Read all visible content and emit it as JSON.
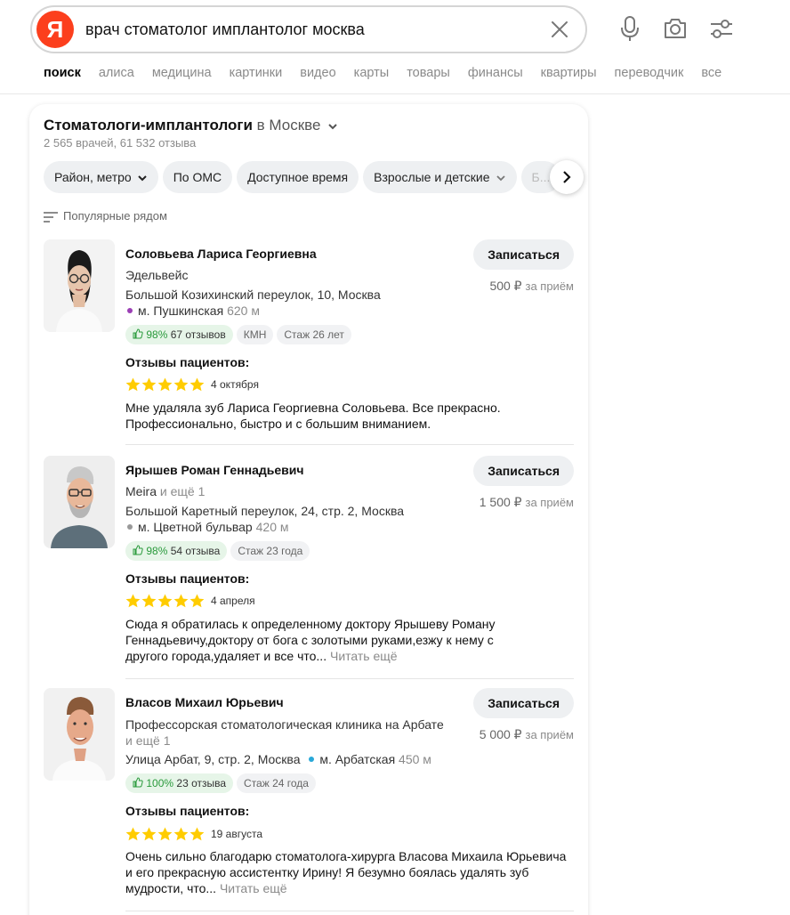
{
  "search": {
    "logo": "Я",
    "query": "врач стоматолог имплантолог москва"
  },
  "tabs": [
    "поиск",
    "алиса",
    "медицина",
    "картинки",
    "видео",
    "карты",
    "товары",
    "финансы",
    "квартиры",
    "переводчик",
    "все"
  ],
  "card": {
    "title": "Стоматологи-имплантологи",
    "location": "в Москве",
    "subtitle": "2 565 врачей, 61 532 отзыва",
    "filters": [
      "Район, метро",
      "По ОМС",
      "Доступное время",
      "Взрослые и детские",
      "Б..."
    ],
    "sort_label": "Популярные рядом",
    "reviews_heading": "Отзывы пациентов:",
    "book_label": "Записаться",
    "read_more": "Читать ещё"
  },
  "doctors": [
    {
      "name": "Соловьева Лариса Георгиевна",
      "clinic": "Эдельвейс",
      "clinic_extra": "",
      "address": "Большой Козихинский переулок, 10, Москва",
      "metro": "м. Пушкинская",
      "metro_distance": "620 м",
      "metro_color": "#9b3fb5",
      "rating_pct": "98%",
      "reviews_count": "67 отзывов",
      "tag": "КМН",
      "experience": "Стаж 26 лет",
      "price": "500 ₽",
      "price_unit": "за приём",
      "review_date": "4 октября",
      "review_stars": 5,
      "review_text": "Мне удаляла зуб Лариса Георгиевна Соловьева. Все прекрасно. Профессионально, быстро и с большим вниманием.",
      "review_more": ""
    },
    {
      "name": "Ярышев Роман Геннадьевич",
      "clinic": "Meira",
      "clinic_extra": "и ещё 1",
      "address": "Большой Каретный переулок, 24, стр. 2, Москва",
      "metro": "м. Цветной бульвар",
      "metro_distance": "420 м",
      "metro_color": "#999999",
      "rating_pct": "98%",
      "reviews_count": "54 отзыва",
      "tag": "",
      "experience": "Стаж 23 года",
      "price": "1 500 ₽",
      "price_unit": "за приём",
      "review_date": "4 апреля",
      "review_stars": 5,
      "review_text": "Сюда я обратилась к определенному доктору Ярышеву Роману Геннадьевичу,доктору от бога с золотыми руками,езжу к нему с другого города,удаляет и все что...",
      "review_more": "Читать ещё"
    },
    {
      "name": "Власов Михаил Юрьевич",
      "clinic": "Профессорская стоматологическая клиника на Арбате",
      "clinic_extra": "и ещё 1",
      "address": "Улица Арбат, 9, стр. 2, Москва",
      "metro": "м. Арбатская",
      "metro_distance": "450 м",
      "metro_color": "#29a8d8",
      "rating_pct": "100%",
      "reviews_count": "23 отзыва",
      "tag": "",
      "experience": "Стаж 24 года",
      "price": "5 000 ₽",
      "price_unit": "за приём",
      "review_date": "19 августа",
      "review_stars": 5,
      "review_text": "Очень сильно благодарю стоматолога-хирурга Власова Михаила Юрьевича и его прекрасную ассистентку Ирину! Я безумно боялась удалять зуб мудрости, что...",
      "review_more": "Читать ещё"
    }
  ],
  "colors": {
    "brand": "#fc3f1d",
    "star": "#ffcc00",
    "positive": "#2a9a3c"
  }
}
